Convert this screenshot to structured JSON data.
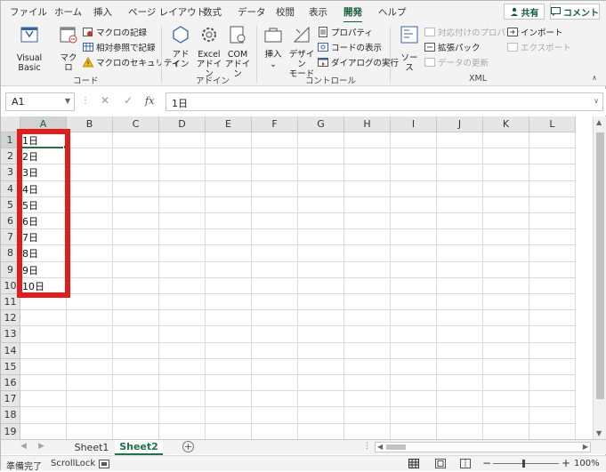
{
  "tabs": [
    "ファイル",
    "ホーム",
    "挿入",
    "ページ レイアウト",
    "数式",
    "データ",
    "校閲",
    "表示",
    "開発",
    "ヘルプ"
  ],
  "active_tab": "開発",
  "share_label": "共有",
  "comment_label": "コメント",
  "ribbon": {
    "code": {
      "label": "コード",
      "visual_basic": "Visual Basic",
      "macro": "マクロ",
      "record_macro": "マクロの記録",
      "relative_ref": "相対参照で記録",
      "macro_security": "マクロのセキュリティ"
    },
    "addins": {
      "label": "アドイン",
      "addin_1": "アド",
      "addin_2": "イン",
      "excel_1": "Excel",
      "excel_2": "アドイン",
      "com_1": "COM",
      "com_2": "アドイン"
    },
    "controls": {
      "label": "コントロール",
      "insert_1": "挿入",
      "insert_2": "⌄",
      "design_1": "デザイン",
      "design_2": "モード",
      "properties": "プロパティ",
      "view_code": "コードの表示",
      "run_dialog": "ダイアログの実行"
    },
    "xml": {
      "label": "XML",
      "source": "ソース",
      "map_props": "対応付けのプロパティ",
      "expansion_pack": "拡張パック",
      "refresh_data": "データの更新",
      "import": "インポート",
      "export": "エクスポート"
    }
  },
  "formula_bar": {
    "name_box": "A1",
    "fx": "fx",
    "value": "1日"
  },
  "columns": [
    "A",
    "B",
    "C",
    "D",
    "E",
    "F",
    "G",
    "H",
    "I",
    "J",
    "K",
    "L"
  ],
  "rows": [
    "1",
    "2",
    "3",
    "4",
    "5",
    "6",
    "7",
    "8",
    "9",
    "10",
    "11",
    "12",
    "13",
    "14",
    "15",
    "16",
    "17",
    "18",
    "19"
  ],
  "cells_A": [
    "1日",
    "2日",
    "3日",
    "4日",
    "5日",
    "6日",
    "7日",
    "8日",
    "9日",
    "10日"
  ],
  "sheets": [
    "Sheet1",
    "Sheet2"
  ],
  "active_sheet": "Sheet2",
  "status": {
    "ready": "準備完了",
    "scroll_lock": "ScrollLock",
    "zoom": "100%"
  },
  "colors": {
    "accent": "#217346",
    "highlight": "#e21b1b"
  }
}
